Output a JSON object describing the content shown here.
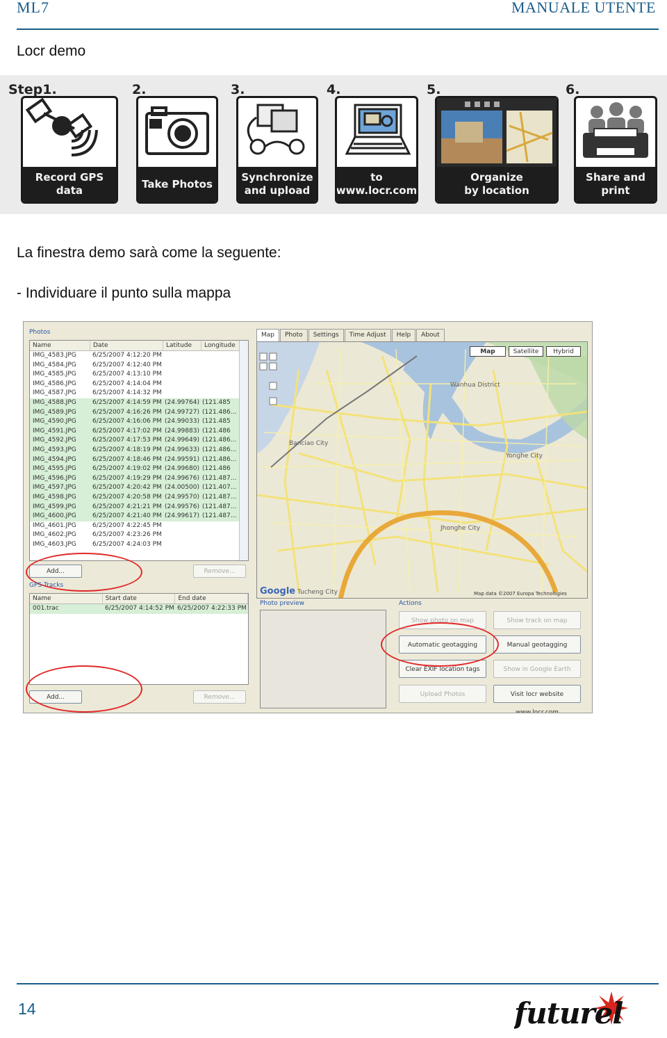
{
  "header": {
    "left": "ML7",
    "right": "MANUALE UTENTE"
  },
  "section_title": "Locr demo",
  "steps": [
    {
      "num": "Step1.",
      "caption": "Record GPS\ndata",
      "icon": "satellite-icon"
    },
    {
      "num": "2.",
      "caption": "Take Photos",
      "icon": "camera-icon"
    },
    {
      "num": "3.",
      "caption": "Synchronize\nand upload",
      "icon": "sync-photos-icon"
    },
    {
      "num": "4.",
      "caption": "to\nwww.locr.com",
      "icon": "laptop-icon"
    },
    {
      "num": "5.",
      "caption": "Organize\nby location",
      "icon": "map-photos-icon"
    },
    {
      "num": "6.",
      "caption": "Share and\nprint",
      "icon": "printer-people-icon"
    }
  ],
  "para1": "La finestra demo sarà come la seguente:",
  "para2": "- Individuare il punto sulla mappa",
  "app": {
    "photos_group": "Photos",
    "photos_columns": [
      "Name",
      "Date",
      "Latitude",
      "Longitude"
    ],
    "photos_rows": [
      {
        "name": "IMG_4583.JPG",
        "date": "6/25/2007 4:12:20 PM",
        "lat": "",
        "lon": "",
        "sel": false
      },
      {
        "name": "IMG_4584.JPG",
        "date": "6/25/2007 4:12:40 PM",
        "lat": "",
        "lon": "",
        "sel": false
      },
      {
        "name": "IMG_4585.JPG",
        "date": "6/25/2007 4:13:10 PM",
        "lat": "",
        "lon": "",
        "sel": false
      },
      {
        "name": "IMG_4586.JPG",
        "date": "6/25/2007 4:14:04 PM",
        "lat": "",
        "lon": "",
        "sel": false
      },
      {
        "name": "IMG_4587.JPG",
        "date": "6/25/2007 4:14:32 PM",
        "lat": "",
        "lon": "",
        "sel": false
      },
      {
        "name": "IMG_4588.JPG",
        "date": "6/25/2007 4:14:59 PM",
        "lat": "(24.99764)",
        "lon": "(121.485",
        "sel": true
      },
      {
        "name": "IMG_4589.JPG",
        "date": "6/25/2007 4:16:26 PM",
        "lat": "(24.99727)",
        "lon": "(121.486...",
        "sel": true
      },
      {
        "name": "IMG_4590.JPG",
        "date": "6/25/2007 4:16:06 PM",
        "lat": "(24.99033)",
        "lon": "(121.485",
        "sel": true
      },
      {
        "name": "IMG_4591.JPG",
        "date": "6/25/2007 4:17:02 PM",
        "lat": "(24.99883)",
        "lon": "(121.486",
        "sel": true
      },
      {
        "name": "IMG_4592.JPG",
        "date": "6/25/2007 4:17:53 PM",
        "lat": "(24.99649)",
        "lon": "(121.486...",
        "sel": true
      },
      {
        "name": "IMG_4593.JPG",
        "date": "6/25/2007 4:18:19 PM",
        "lat": "(24.99633)",
        "lon": "(121.486...",
        "sel": true
      },
      {
        "name": "IMG_4594.JPG",
        "date": "6/25/2007 4:18:46 PM",
        "lat": "(24.99591)",
        "lon": "(121.486...",
        "sel": true
      },
      {
        "name": "IMG_4595.JPG",
        "date": "6/25/2007 4:19:02 PM",
        "lat": "(24.99680)",
        "lon": "(121.486",
        "sel": true
      },
      {
        "name": "IMG_4596.JPG",
        "date": "6/25/2007 4:19:29 PM",
        "lat": "(24.99676)",
        "lon": "(121.487...",
        "sel": true
      },
      {
        "name": "IMG_4597.JPG",
        "date": "6/25/2007 4:20:42 PM",
        "lat": "(24.00500)",
        "lon": "(121.407...",
        "sel": true
      },
      {
        "name": "IMG_4598.JPG",
        "date": "6/25/2007 4:20:58 PM",
        "lat": "(24.99570)",
        "lon": "(121.487...",
        "sel": true
      },
      {
        "name": "IMG_4599.JPG",
        "date": "6/25/2007 4:21:21 PM",
        "lat": "(24.99576)",
        "lon": "(121.487...",
        "sel": true
      },
      {
        "name": "IMG_4600.JPG",
        "date": "6/25/2007 4:21:40 PM",
        "lat": "(24.99617)",
        "lon": "(121.487...",
        "sel": true
      },
      {
        "name": "IMG_4601.JPG",
        "date": "6/25/2007 4:22:45 PM",
        "lat": "",
        "lon": "",
        "sel": false
      },
      {
        "name": "IMG_4602.JPG",
        "date": "6/25/2007 4:23:26 PM",
        "lat": "",
        "lon": "",
        "sel": false
      },
      {
        "name": "IMG_4603.JPG",
        "date": "6/25/2007 4:24:03 PM",
        "lat": "",
        "lon": "",
        "sel": false
      }
    ],
    "add_photos": "Add...",
    "remove_photos": "Remove...",
    "gps_group": "GPS Tracks",
    "gps_columns": [
      "Name",
      "Start date",
      "End date"
    ],
    "gps_rows": [
      {
        "name": "001.trac",
        "start": "6/25/2007 4:14:52 PM",
        "end": "6/25/2007 4:22:33 PM"
      }
    ],
    "add_tracks": "Add...",
    "remove_tracks": "Remove...",
    "tabs": [
      "Map",
      "Photo",
      "Settings",
      "Time Adjust",
      "Help",
      "About"
    ],
    "map_buttons": [
      "Map",
      "Satellite",
      "Hybrid"
    ],
    "map_labels": {
      "banciao": "Banciao City",
      "yonghe": "Yonghe City",
      "jhonghe": "Jhonghe City",
      "wanhua": "Wanhua District",
      "tucheng": "Tucheng City",
      "google": "Google",
      "map_data": "Map data ©2007 Europa Technologies"
    },
    "photo_preview": "Photo preview",
    "actions_group": "Actions",
    "actions": {
      "show_photo": "Show photo on map",
      "show_track": "Show track on map",
      "auto_geotag": "Automatic geotagging",
      "manual_geotag": "Manual geotagging",
      "clear_exif": "Clear EXIF location tags",
      "show_earth": "Show in Google Earth",
      "upload": "Upload Photos",
      "visit": "Visit locr website www.locr.com"
    }
  },
  "footer": {
    "page": "14",
    "logo": "futurel"
  },
  "colors": {
    "accent": "#1a5c8a",
    "annotation": "#e02828"
  }
}
